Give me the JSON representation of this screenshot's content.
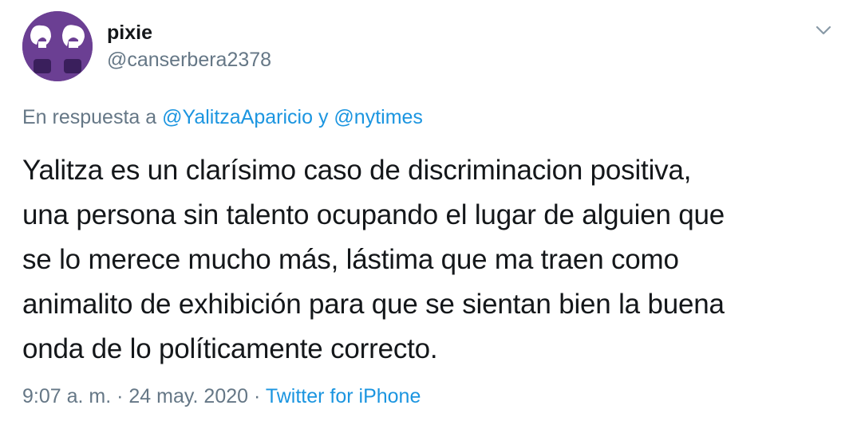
{
  "tweet": {
    "display_name": "pixie",
    "handle": "@canserbera2378",
    "reply": {
      "prefix": "En respuesta a",
      "mention_1": "@YalitzaAparicio",
      "connector": "y",
      "mention_2": "@nytimes"
    },
    "body_lines": [
      "Yalitza es un clarísimo caso de discriminacion positiva,",
      "una persona sin talento ocupando el lugar de alguien que",
      "se lo merece mucho más, lástima que ma traen como",
      "animalito de exhibición para que se sientan bien la buena",
      "onda de lo políticamente correcto."
    ],
    "time": "9:07 a. m.",
    "separator": "·",
    "date": "24 may. 2020",
    "source": "Twitter for iPhone"
  },
  "colors": {
    "text": "#14171a",
    "secondary": "#657786",
    "link": "#1b95e0",
    "avatar_bg": "#6b3f93"
  },
  "icons": {
    "avatar": "avatar-image",
    "menu": "chevron-down-icon"
  }
}
